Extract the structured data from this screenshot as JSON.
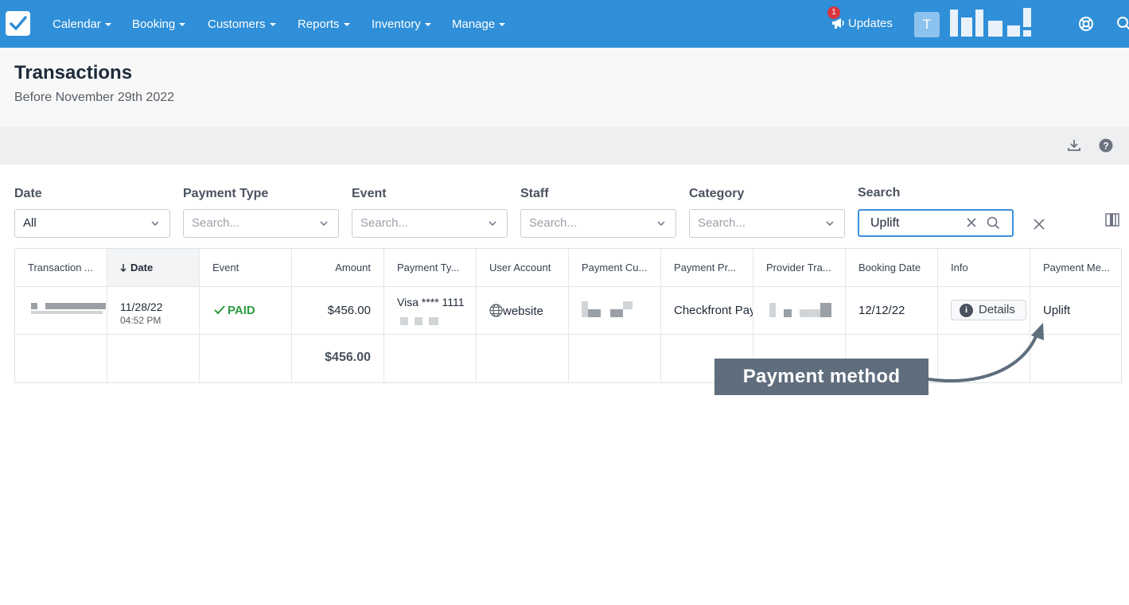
{
  "nav": {
    "items": [
      "Calendar",
      "Booking",
      "Customers",
      "Reports",
      "Inventory",
      "Manage"
    ],
    "updates_label": "Updates",
    "updates_count": "1",
    "avatar_initial": "T",
    "accent_color": "#2f8fd8"
  },
  "page": {
    "title": "Transactions",
    "subtitle": "Before November 29th 2022"
  },
  "filters": {
    "date": {
      "label": "Date",
      "value": "All"
    },
    "payment_type": {
      "label": "Payment Type",
      "placeholder": "Search..."
    },
    "event": {
      "label": "Event",
      "placeholder": "Search..."
    },
    "staff": {
      "label": "Staff",
      "placeholder": "Search..."
    },
    "category": {
      "label": "Category",
      "placeholder": "Search..."
    },
    "search": {
      "label": "Search",
      "value": "Uplift"
    }
  },
  "table": {
    "columns": [
      "Transaction ...",
      "Date",
      "Event",
      "Amount",
      "Payment Ty...",
      "User Account",
      "Payment Cu...",
      "Payment Pr...",
      "Provider Tra...",
      "Booking Date",
      "Info",
      "Payment Me..."
    ],
    "row": {
      "date": "11/28/22",
      "time": "04:52 PM",
      "event": "PAID",
      "amount": "$456.00",
      "payment_type": "Visa **** 1111",
      "user_account": "website",
      "payment_provider": "Checkfront Pay",
      "booking_date": "12/12/22",
      "info_button": "Details",
      "payment_method": "Uplift"
    },
    "total_amount": "$456.00"
  },
  "callout": {
    "text": "Payment method"
  },
  "icons": [
    "checkfront-logo-icon",
    "megaphone-icon",
    "lifebuoy-icon",
    "search-icon",
    "download-icon",
    "help-icon",
    "chevron-down-icon",
    "clear-icon",
    "close-icon",
    "columns-icon",
    "globe-icon",
    "check-icon",
    "info-icon",
    "sort-arrow-icon"
  ]
}
